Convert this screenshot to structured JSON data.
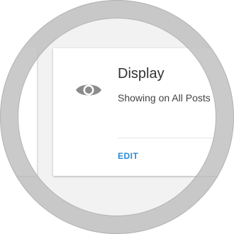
{
  "card": {
    "icon": "eye-icon",
    "title": "Display",
    "subtitle": "Showing on All Posts",
    "edit_label": "EDIT"
  },
  "colors": {
    "accent": "#2b8bd6",
    "icon": "#8c8c8c",
    "ring": "#bebebe",
    "background": "#f2f2f2"
  }
}
